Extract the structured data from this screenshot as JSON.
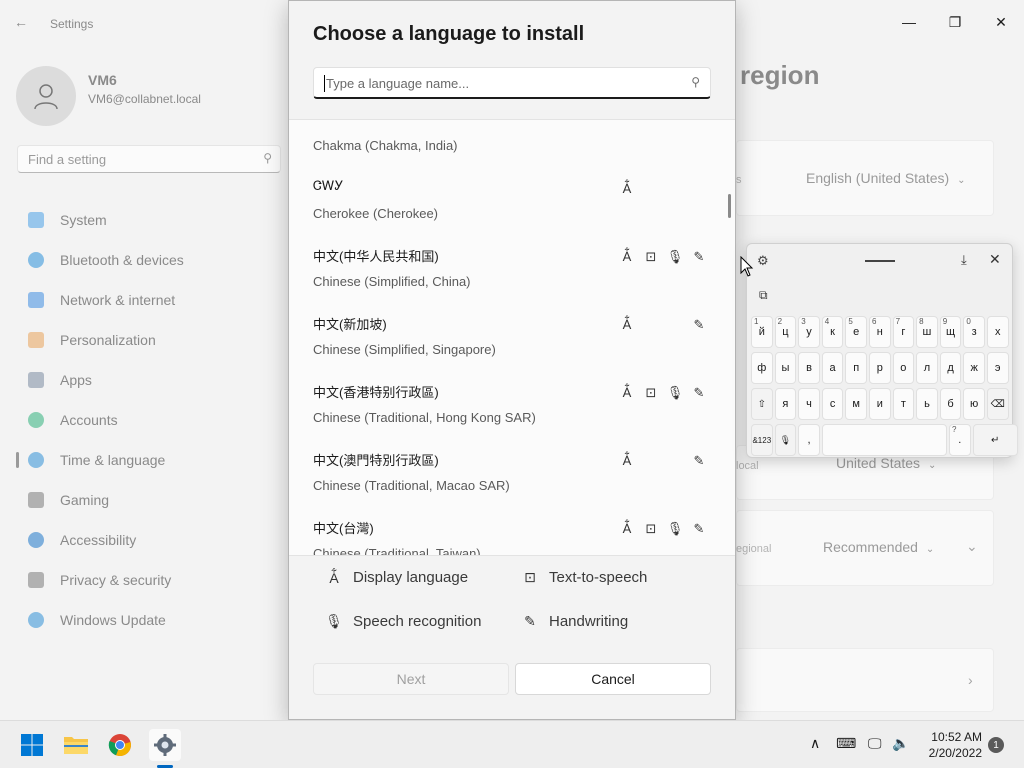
{
  "settings": {
    "app_title": "Settings",
    "user_name": "VM6",
    "user_email": "VM6@collabnet.local",
    "find_placeholder": "Find a setting",
    "nav": [
      {
        "label": "System",
        "color": "#4aa0e6"
      },
      {
        "label": "Bluetooth & devices",
        "color": "#2a8fd8"
      },
      {
        "label": "Network & internet",
        "color": "#3e8de0"
      },
      {
        "label": "Personalization",
        "color": "#e8a25a"
      },
      {
        "label": "Apps",
        "color": "#7a8aa0"
      },
      {
        "label": "Accounts",
        "color": "#2fb17b"
      },
      {
        "label": "Time & language",
        "color": "#2f8fd6"
      },
      {
        "label": "Gaming",
        "color": "#7a7a7a"
      },
      {
        "label": "Accessibility",
        "color": "#1d76c9"
      },
      {
        "label": "Privacy & security",
        "color": "#7a7a7a"
      },
      {
        "label": "Windows Update",
        "color": "#2f8fd6"
      }
    ],
    "heading_partial": "region",
    "language_value": "English (United States)",
    "country_value": "United States",
    "country_label_partial": "local",
    "regional_label_partial": "egional",
    "regional_format_value": "Recommended",
    "s_partial": "s"
  },
  "dialog": {
    "title": "Choose a language to install",
    "search_placeholder": "Type a language name...",
    "languages": [
      {
        "native": "",
        "english": "Chakma (Chakma, India)",
        "features": []
      },
      {
        "native": "ᏣᎳᎩ",
        "english": "Cherokee (Cherokee)",
        "features": [
          "display"
        ]
      },
      {
        "native": "中文(中华人民共和国)",
        "english": "Chinese (Simplified, China)",
        "features": [
          "display",
          "tts",
          "speech",
          "handwriting"
        ]
      },
      {
        "native": "中文(新加坡)",
        "english": "Chinese (Simplified, Singapore)",
        "features": [
          "display",
          "handwriting"
        ]
      },
      {
        "native": "中文(香港特别行政區)",
        "english": "Chinese (Traditional, Hong Kong SAR)",
        "features": [
          "display",
          "tts",
          "speech",
          "handwriting"
        ]
      },
      {
        "native": "中文(澳門特別行政區)",
        "english": "Chinese (Traditional, Macao SAR)",
        "features": [
          "display",
          "handwriting"
        ]
      },
      {
        "native": "中文(台灣)",
        "english": "Chinese (Traditional, Taiwan)",
        "features": [
          "display",
          "tts",
          "speech",
          "handwriting"
        ]
      }
    ],
    "legend": {
      "display": "Display language",
      "tts": "Text-to-speech",
      "speech": "Speech recognition",
      "handwriting": "Handwriting"
    },
    "next_label": "Next",
    "cancel_label": "Cancel"
  },
  "keyboard": {
    "row1": [
      {
        "k": "й",
        "s": "1"
      },
      {
        "k": "ц",
        "s": "2"
      },
      {
        "k": "у",
        "s": "3"
      },
      {
        "k": "к",
        "s": "4"
      },
      {
        "k": "е",
        "s": "5"
      },
      {
        "k": "н",
        "s": "6"
      },
      {
        "k": "г",
        "s": "7"
      },
      {
        "k": "ш",
        "s": "8"
      },
      {
        "k": "щ",
        "s": "9"
      },
      {
        "k": "з",
        "s": "0"
      },
      {
        "k": "х",
        "s": ""
      }
    ],
    "row2": [
      "ф",
      "ы",
      "в",
      "а",
      "п",
      "р",
      "о",
      "л",
      "д",
      "ж",
      "э"
    ],
    "row3": [
      "⇧",
      "я",
      "ч",
      "с",
      "м",
      "и",
      "т",
      "ь",
      "б",
      "ю",
      "⌫"
    ],
    "sym_key": "&123",
    "mic_key": "🎙",
    "comma_key": ",",
    "period_key": ".",
    "period_sup": "?",
    "enter_key": "↵"
  },
  "taskbar": {
    "time": "10:52 AM",
    "date": "2/20/2022",
    "notification_count": "1"
  },
  "colors": {
    "accent": "#0067c0"
  }
}
